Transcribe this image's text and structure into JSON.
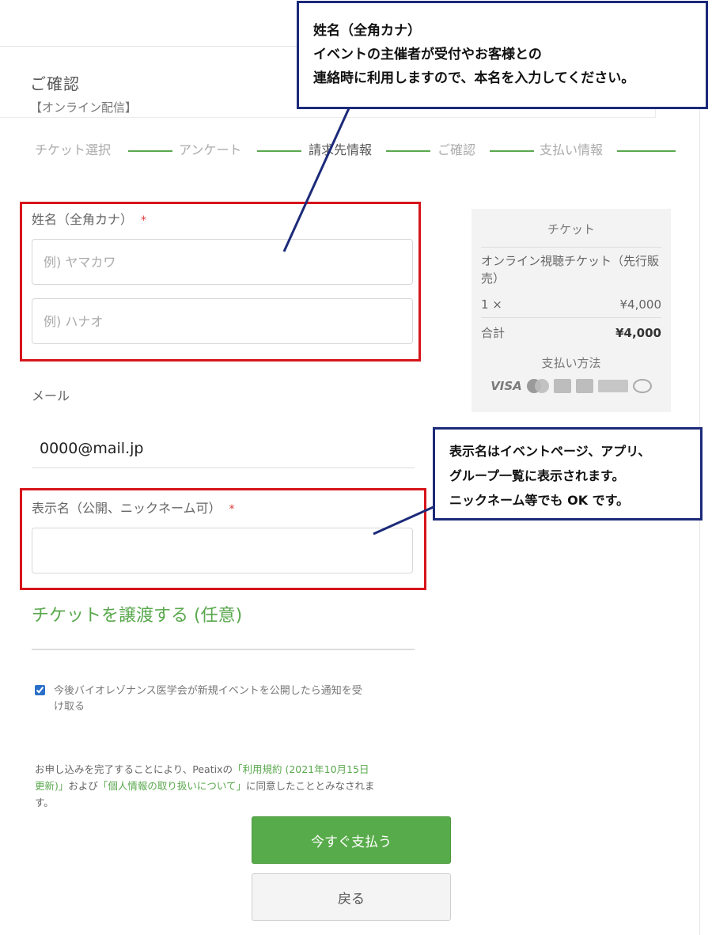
{
  "page": {
    "title": "ご確認",
    "event_name": "【オンライン配信】"
  },
  "steps": [
    "チケット選択",
    "アンケート",
    "請求先情報",
    "ご確認",
    "支払い情報"
  ],
  "form": {
    "name_label": "姓名（全角カナ）",
    "required_mark": "*",
    "last_name_placeholder": "例) ヤマカワ",
    "first_name_placeholder": "例) ハナオ",
    "email_label": "メール",
    "email_value": "0000@mail.jp",
    "display_name_label": "表示名（公開、ニックネーム可）",
    "display_name_value": "",
    "transfer_link": "チケットを譲渡する (任意)",
    "notify_checked": true,
    "notify_text": "今後バイオレゾナンス医学会が新規イベントを公開したら通知を受け取る",
    "terms_before": "お申し込みを完了することにより、Peatixの",
    "terms_link1": "「利用規約 (2021年10月15日更新)」",
    "terms_middle": "および",
    "terms_link2": "「個人情報の取り扱いについて」",
    "terms_after": "に同意したこととみなされます。",
    "pay_button": "今すぐ支払う",
    "back_button": "戻る"
  },
  "summary": {
    "header": "チケット",
    "ticket_name": "オンライン視聴チケット（先行販売）",
    "qty": "1 ×",
    "price": "¥4,000",
    "total_label": "合計",
    "total_value": "¥4,000",
    "payment_title": "支払い方法",
    "card_visa": "VISA"
  },
  "annotations": {
    "name_note": [
      "姓名（全角カナ）",
      "イベントの主催者が受付やお客様との",
      "連絡時に利用しますので、本名を入力してください。"
    ],
    "display_note": [
      "表示名はイベントページ、アプリ、",
      "グループ一覧に表示されます。",
      "ニックネーム等でも OK です。"
    ]
  },
  "colors": {
    "accent_green": "#58ab4a",
    "annotation_red": "#d6151b",
    "annotation_navy": "#1c2a7a"
  }
}
